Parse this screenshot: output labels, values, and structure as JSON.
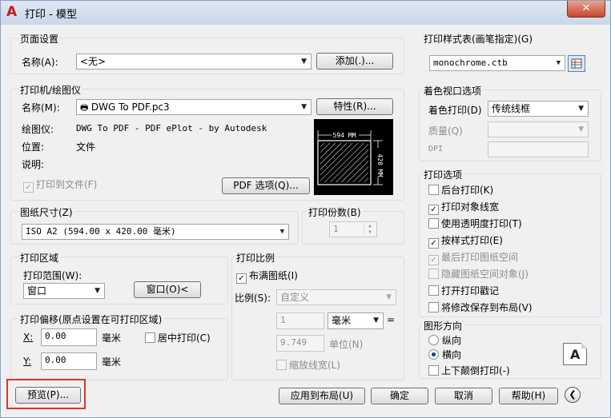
{
  "window": {
    "title": "打印 - 模型",
    "close_label": "✕"
  },
  "page_setup": {
    "group_label": "页面设置",
    "name_label": "名称(A):",
    "name_value": "<无>",
    "add_button": "添加(.)..."
  },
  "plotter": {
    "group_label": "打印机/绘图仪",
    "name_label": "名称(M):",
    "name_value": "DWG To PDF.pc3",
    "properties_button": "特性(R)...",
    "plotter_label": "绘图仪:",
    "plotter_value": "DWG To PDF - PDF ePlot - by Autodesk",
    "location_label": "位置:",
    "location_value": "文件",
    "description_label": "说明:",
    "plot_to_file": "打印到文件(F)",
    "pdf_options_button": "PDF 选项(Q)...",
    "preview_width": "594 MM",
    "preview_height": "420 MM"
  },
  "paper_size": {
    "group_label": "图纸尺寸(Z)",
    "value": "ISO A2 (594.00 x 420.00 毫米)"
  },
  "copies": {
    "group_label": "打印份数(B)",
    "value": "1"
  },
  "plot_area": {
    "group_label": "打印区域",
    "range_label": "打印范围(W):",
    "range_value": "窗口",
    "window_button": "窗口(O)<"
  },
  "plot_offset": {
    "group_label": "打印偏移(原点设置在可打印区域)",
    "x_label": "X:",
    "x_value": "0.00",
    "x_unit": "毫米",
    "y_label": "Y:",
    "y_value": "0.00",
    "y_unit": "毫米",
    "center": "居中打印(C)"
  },
  "plot_scale": {
    "group_label": "打印比例",
    "fit_paper": "布满图纸(I)",
    "scale_label": "比例(S):",
    "scale_value": "自定义",
    "value1": "1",
    "unit_value": "毫米",
    "equals": "=",
    "value2": "9.749",
    "unit_label": "单位(N)",
    "scale_lineweights": "缩放线宽(L)"
  },
  "plot_style_table": {
    "group_label": "打印样式表(画笔指定)(G)",
    "value": "monochrome.ctb"
  },
  "shaded_viewport": {
    "group_label": "着色视口选项",
    "shade_label": "着色打印(D)",
    "shade_value": "传统线框",
    "quality_label": "质量(Q)",
    "dpi_label": "DPI"
  },
  "plot_options": {
    "group_label": "打印选项",
    "items": [
      {
        "label": "后台打印(K)",
        "checked": false,
        "disabled": false
      },
      {
        "label": "打印对象线宽",
        "checked": true,
        "disabled": false
      },
      {
        "label": "使用透明度打印(T)",
        "checked": false,
        "disabled": false
      },
      {
        "label": "按样式打印(E)",
        "checked": true,
        "disabled": false
      },
      {
        "label": "最后打印图纸空间",
        "checked": true,
        "disabled": true
      },
      {
        "label": "隐藏图纸空间对象(J)",
        "checked": false,
        "disabled": true
      },
      {
        "label": "打开打印戳记",
        "checked": false,
        "disabled": false
      },
      {
        "label": "将修改保存到布局(V)",
        "checked": false,
        "disabled": false
      }
    ]
  },
  "orientation": {
    "group_label": "图形方向",
    "portrait": "纵向",
    "landscape": "横向",
    "upside_down": "上下颠倒打印(-)",
    "icon_letter": "A"
  },
  "footer": {
    "preview_button": "预览(P)...",
    "apply_button": "应用到布局(U)",
    "ok_button": "确定",
    "cancel_button": "取消",
    "help_button": "帮助(H)"
  }
}
